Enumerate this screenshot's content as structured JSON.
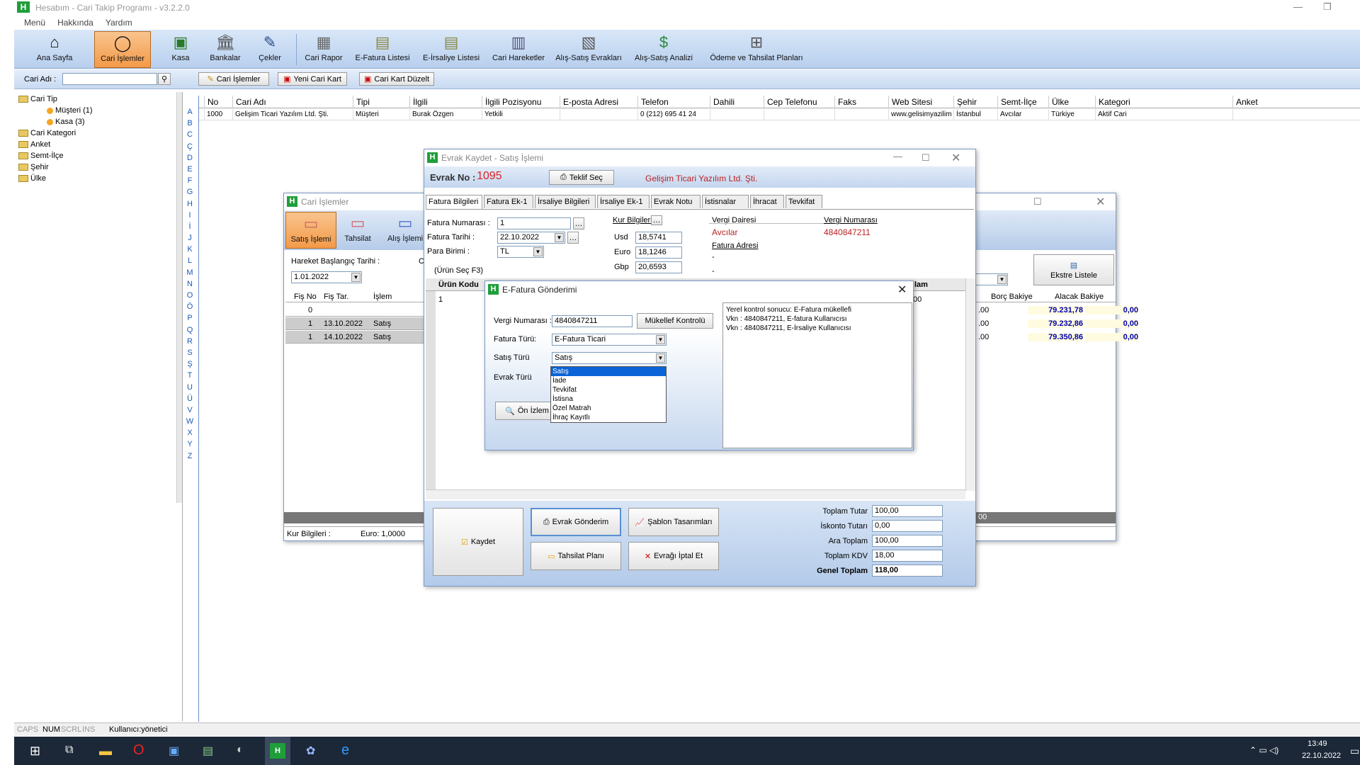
{
  "app": {
    "title": "Hesabım - Cari Takip Programı - v3.2.2.0"
  },
  "menu": [
    "Menü",
    "Hakkında",
    "Yardım"
  ],
  "toolbar": [
    {
      "label": "Ana Sayfa",
      "icon": "home-icon"
    },
    {
      "label": "Cari İşlemler",
      "icon": "user-icon",
      "active": true
    },
    {
      "label": "Kasa",
      "icon": "cash-icon"
    },
    {
      "label": "Bankalar",
      "icon": "bank-icon"
    },
    {
      "label": "Çekler",
      "icon": "cheque-icon"
    },
    {
      "label": "Cari Rapor",
      "icon": "report-icon"
    },
    {
      "label": "E-Fatura Listesi",
      "icon": "invoice-icon"
    },
    {
      "label": "E-İrsaliye Listesi",
      "icon": "waybill-icon"
    },
    {
      "label": "Cari Hareketler",
      "icon": "movements-icon"
    },
    {
      "label": "Alış-Satış Evrakları",
      "icon": "documents-icon"
    },
    {
      "label": "Alış-Satış Analizi",
      "icon": "analysis-icon"
    },
    {
      "label": "Ödeme ve Tahsilat Planları",
      "icon": "plan-icon"
    }
  ],
  "subbar": {
    "cari_adi_label": "Cari Adı :",
    "btn_cari_islemler": "Cari İşlemler",
    "btn_yeni": "Yeni Cari Kart",
    "btn_duzelt": "Cari Kart Düzelt"
  },
  "tree": [
    "Cari Tip",
    "Müşteri (1)",
    "Kasa (3)",
    "Cari Kategori",
    "Anket",
    "Semt-İlçe",
    "Şehir",
    "Ülke"
  ],
  "alphabet": [
    "A",
    "B",
    "C",
    "Ç",
    "D",
    "E",
    "F",
    "G",
    "H",
    "I",
    "İ",
    "J",
    "K",
    "L",
    "M",
    "N",
    "O",
    "Ö",
    "P",
    "Q",
    "R",
    "S",
    "Ş",
    "T",
    "U",
    "Ü",
    "V",
    "W",
    "X",
    "Y",
    "Z"
  ],
  "grid": {
    "headers": [
      "No",
      "Cari Adı",
      "Tipi",
      "İlgili",
      "İlgili Pozisyonu",
      "E-posta Adresi",
      "Telefon",
      "Dahili",
      "Cep Telefonu",
      "Faks",
      "Web Sitesi",
      "Şehir",
      "Semt-İlçe",
      "Ülke",
      "Kategori",
      "Anket"
    ],
    "row": [
      "1000",
      "Gelişim Ticari Yazılım Ltd. Şti.",
      "Müşteri",
      "Burak Özgen",
      "Yetkili",
      "",
      "0 (212) 695 41 24",
      "",
      "",
      "",
      "www.gelisimyazilim",
      "İstanbul",
      "Avcılar",
      "Türkiye",
      "Aktif Cari",
      ""
    ]
  },
  "cari_win": {
    "title": "Cari İşlemler",
    "btns": [
      "Satış İşlemi",
      "Tahsilat",
      "Alış İşlemi"
    ],
    "hareket_label": "Hareket Başlangıç Tarihi :",
    "date": "1.01.2022",
    "c_label": "C",
    "cols": [
      "Fiş No",
      "Fiş Tar.",
      "İşlem"
    ],
    "rows": [
      [
        "0",
        "",
        ""
      ],
      [
        "1",
        "13.10.2022",
        "Satış"
      ],
      [
        "1",
        "14.10.2022",
        "Satış"
      ]
    ],
    "right_cols": [
      "Borç Bakiye",
      "Alacak Bakiye"
    ],
    "right_rows": [
      [
        ".00",
        "79.231,78",
        "0,00"
      ],
      [
        ".00",
        "79.232,86",
        "0,00"
      ],
      [
        ".00",
        "79.350,86",
        "0,00"
      ]
    ],
    "ekstre": "Ekstre Listele",
    "kur_label": "Kur Bilgileri :",
    "kur_val": "Euro: 1,0000",
    "footer_right": "00"
  },
  "evrak_win": {
    "title": "Evrak Kaydet - Satış İşlemi",
    "evrak_no_label": "Evrak No :",
    "evrak_no": "1095",
    "teklif_btn": "Teklif Seç",
    "company": "Gelişim Ticari Yazılım Ltd. Şti.",
    "tabs": [
      "Fatura Bilgileri",
      "Fatura Ek-1",
      "İrsaliye Bilgileri",
      "İrsaliye Ek-1",
      "Evrak Notu",
      "İstisnalar",
      "İhracat",
      "Tevkifat"
    ],
    "fatura_no_label": "Fatura Numarası :",
    "fatura_no": "1",
    "fatura_tarih_label": "Fatura Tarihi :",
    "fatura_tarih": "22.10.2022",
    "para_label": "Para Birimi :",
    "para": "TL",
    "urun_sec": "(Ürün Seç F3)",
    "kur_label": "Kur Bilgileri",
    "usd_label": "Usd",
    "usd": "18,5741",
    "euro_label": "Euro",
    "euro": "18,1246",
    "gbp_label": "Gbp",
    "gbp": "20,6593",
    "vergi_dairesi_label": "Vergi Dairesi",
    "vergi_dairesi": "Avcılar",
    "fatura_adresi_label": "Fatura Adresi",
    "vergi_no_label": "Vergi Numarası",
    "vergi_no": "4840847211",
    "dash1": "-",
    "dash2": "-",
    "urun_kodu": "Ürün Kodu",
    "first_row": "1",
    "lam": "lam",
    "lam_val": "00",
    "kaydet": "Kaydet",
    "evrak_gonderim": "Evrak Gönderim",
    "sablon": "Şablon Tasarımları",
    "tahsilat_plani": "Tahsilat Planı",
    "iptal": "Evrağı İptal Et",
    "totals": [
      {
        "label": "Toplam Tutar",
        "value": "100,00"
      },
      {
        "label": "İskonto Tutarı",
        "value": "0,00"
      },
      {
        "label": "Ara Toplam",
        "value": "100,00"
      },
      {
        "label": "Toplam KDV",
        "value": "18,00"
      },
      {
        "label": "Genel Toplam",
        "value": "118,00"
      }
    ]
  },
  "efatura": {
    "title": "E-Fatura Gönderimi",
    "vergi_label": "Vergi Numarası :",
    "vergi": "4840847211",
    "mukellef_btn": "Mükellef Kontrolü",
    "fatura_turu_label": "Fatura Türü:",
    "fatura_turu": "E-Fatura Ticari",
    "satis_turu_label": "Satış Türü",
    "satis_turu": "Satış",
    "evrak_turu_label": "Evrak Türü",
    "on_izleme": "Ön İzlem",
    "options": [
      "Satış",
      "İade",
      "Tevkifat",
      "İstisna",
      "Özel Matrah",
      "İhraç Kayıtlı"
    ],
    "result": [
      "Yerel kontrol sonucu: E-Fatura mükellefi",
      "Vkn : 4840847211, E-fatura Kullanıcısı",
      "Vkn : 4840847211, E-İrsaliye Kullanıcısı"
    ]
  },
  "status": {
    "caps": "CAPS",
    "num": "NUM",
    "scrl": "SCRL",
    "ins": "INS",
    "user": "Kullanıcı:yönetici"
  },
  "clock": {
    "time": "13:49",
    "date": "22.10.2022"
  }
}
